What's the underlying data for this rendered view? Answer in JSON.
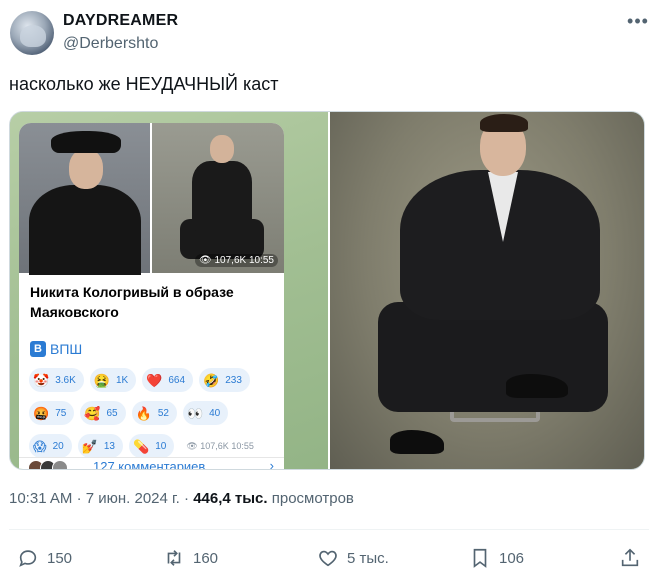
{
  "tweet": {
    "display_name": "DAYDREAMER",
    "handle": "@Derbershto",
    "text": "насколько же НЕУДАЧНЫЙ каст"
  },
  "embedded_post": {
    "title": "Никита Кологривый в образе Маяковского",
    "channel": "ВПШ",
    "photo_views": "107,6K",
    "photo_time": "10:55",
    "reactions_row1": [
      {
        "emoji": "🤡",
        "count": "3.6K"
      },
      {
        "emoji": "🤮",
        "count": "1K"
      },
      {
        "emoji": "❤️",
        "count": "664"
      },
      {
        "emoji": "🤣",
        "count": "233"
      }
    ],
    "reactions_row2": [
      {
        "emoji": "🤬",
        "count": "75"
      },
      {
        "emoji": "🥰",
        "count": "65"
      },
      {
        "emoji": "🔥",
        "count": "52"
      },
      {
        "emoji": "👀",
        "count": "40"
      }
    ],
    "reactions_row3": [
      {
        "emoji": "😱",
        "count": "20"
      },
      {
        "emoji": "💅",
        "count": "13"
      },
      {
        "emoji": "💊",
        "count": "10"
      }
    ],
    "post_views": "107,6K",
    "post_time": "10:55",
    "comments_label": "127 комментариев",
    "comments_chevron": "›"
  },
  "meta": {
    "time": "10:31 AM",
    "date": "7 июн. 2024 г.",
    "views_count": "446,4 тыс.",
    "views_label": "просмотров"
  },
  "actions": {
    "replies": "150",
    "reposts": "160",
    "likes": "5 тыс.",
    "bookmarks": "106"
  },
  "icons": {
    "more": "more-icon",
    "reply": "reply-icon",
    "repost": "repost-icon",
    "like": "heart-icon",
    "bookmark": "bookmark-icon",
    "share": "share-icon",
    "eye": "eye-icon"
  },
  "colors": {
    "accent": "#2b7bd3",
    "muted": "#536471",
    "text": "#0f1419"
  }
}
